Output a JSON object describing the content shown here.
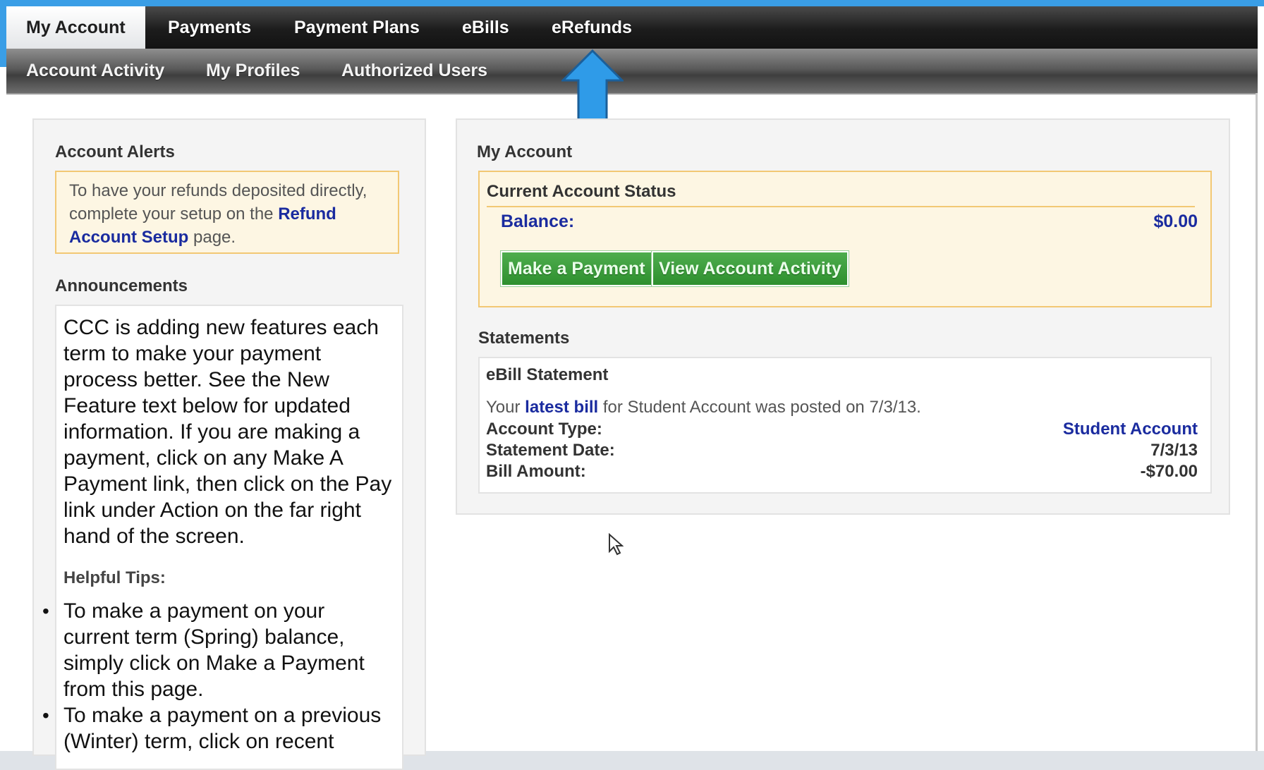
{
  "colors": {
    "accent_blue": "#3a9ee6",
    "link_blue": "#1a2b9f",
    "alert_border": "#f2c874",
    "button_green": "#3e9e3e"
  },
  "main_nav": {
    "items": [
      {
        "label": "My Account",
        "active": true
      },
      {
        "label": "Payments"
      },
      {
        "label": "Payment Plans"
      },
      {
        "label": "eBills"
      },
      {
        "label": "eRefunds"
      }
    ]
  },
  "sub_nav": {
    "items": [
      {
        "label": "Account Activity"
      },
      {
        "label": "My Profiles"
      },
      {
        "label": "Authorized Users"
      }
    ]
  },
  "left_panel": {
    "alerts_heading": "Account Alerts",
    "alert_text_before": "To have your refunds deposited directly, complete your setup on the ",
    "alert_link": "Refund Account Setup",
    "alert_text_after": " page.",
    "announcements_heading": "Announcements",
    "announcement_text": "CCC is adding new features each term to make your payment process better. See the New Feature text below for updated information. If you are making a payment, click on any Make A Payment link, then click on the Pay link under Action on the far right hand of the screen.",
    "tips_label": "Helpful Tips:",
    "tips": [
      "To make a payment on your current term (Spring) balance, simply click on Make a Payment from this page.",
      "To make a payment on a previous (Winter) term, click on recent"
    ]
  },
  "right_panel": {
    "heading": "My Account",
    "status": {
      "title": "Current Account Status",
      "balance_label": "Balance:",
      "balance_value": "$0.00",
      "make_payment_label": "Make a Payment",
      "view_activity_label": "View Account Activity"
    },
    "statements_heading": "Statements",
    "ebill": {
      "title": "eBill Statement",
      "text_before": "Your ",
      "link": "latest bill",
      "text_after": " for Student Account was posted on 7/3/13.",
      "rows": [
        {
          "label": "Account Type:",
          "value": "Student Account"
        },
        {
          "label": "Statement Date:",
          "value": "7/3/13"
        },
        {
          "label": "Bill Amount:",
          "value": "-$70.00"
        }
      ]
    }
  },
  "icons": {
    "annotation_arrow": "up-arrow-icon",
    "mouse_pointer": "cursor-icon"
  }
}
